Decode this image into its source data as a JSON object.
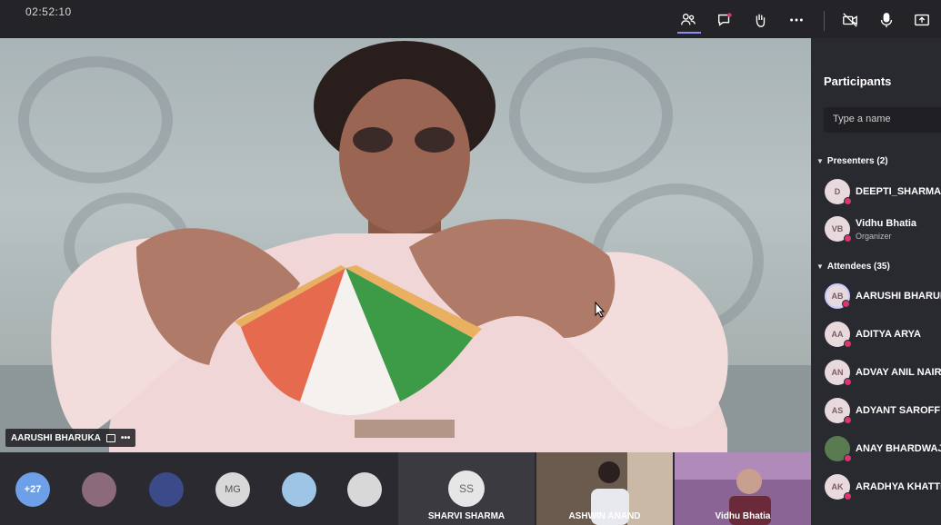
{
  "meeting": {
    "timer": "02:52:10"
  },
  "toolbar": {
    "items": [
      {
        "name": "participants-icon"
      },
      {
        "name": "chat-icon"
      },
      {
        "name": "raise-hand-icon"
      },
      {
        "name": "more-icon"
      },
      {
        "name": "camera-off-icon"
      },
      {
        "name": "microphone-icon"
      },
      {
        "name": "share-screen-icon"
      }
    ]
  },
  "main_video": {
    "speaker_name": "AARUSHI BHARUKA"
  },
  "participants_panel": {
    "title": "Participants",
    "search_placeholder": "Type a name",
    "presenters_header": "Presenters (2)",
    "presenters": [
      {
        "initials": "D",
        "name": "DEEPTI_SHARMA_",
        "role": ""
      },
      {
        "initials": "VB",
        "name": "Vidhu Bhatia",
        "role": "Organizer"
      }
    ],
    "attendees_header": "Attendees (35)",
    "attendees": [
      {
        "initials": "AB",
        "name": "AARUSHI BHARUKA"
      },
      {
        "initials": "AA",
        "name": "ADITYA ARYA"
      },
      {
        "initials": "AN",
        "name": "ADVAY ANIL NAIR"
      },
      {
        "initials": "AS",
        "name": "ADYANT SAROFF"
      },
      {
        "initials": "",
        "name": "ANAY BHARDWAJ"
      },
      {
        "initials": "AK",
        "name": "ARADHYA KHATTRI"
      }
    ]
  },
  "bottom_strip": {
    "overflow_count": "+27",
    "overflow_avatars": [
      "",
      "",
      "MG",
      "",
      ""
    ],
    "tiles": [
      {
        "initials": "SS",
        "name": "SHARVI SHARMA"
      },
      {
        "name": "ASHWIN ANAND"
      },
      {
        "name": "Vidhu Bhatia"
      }
    ]
  }
}
